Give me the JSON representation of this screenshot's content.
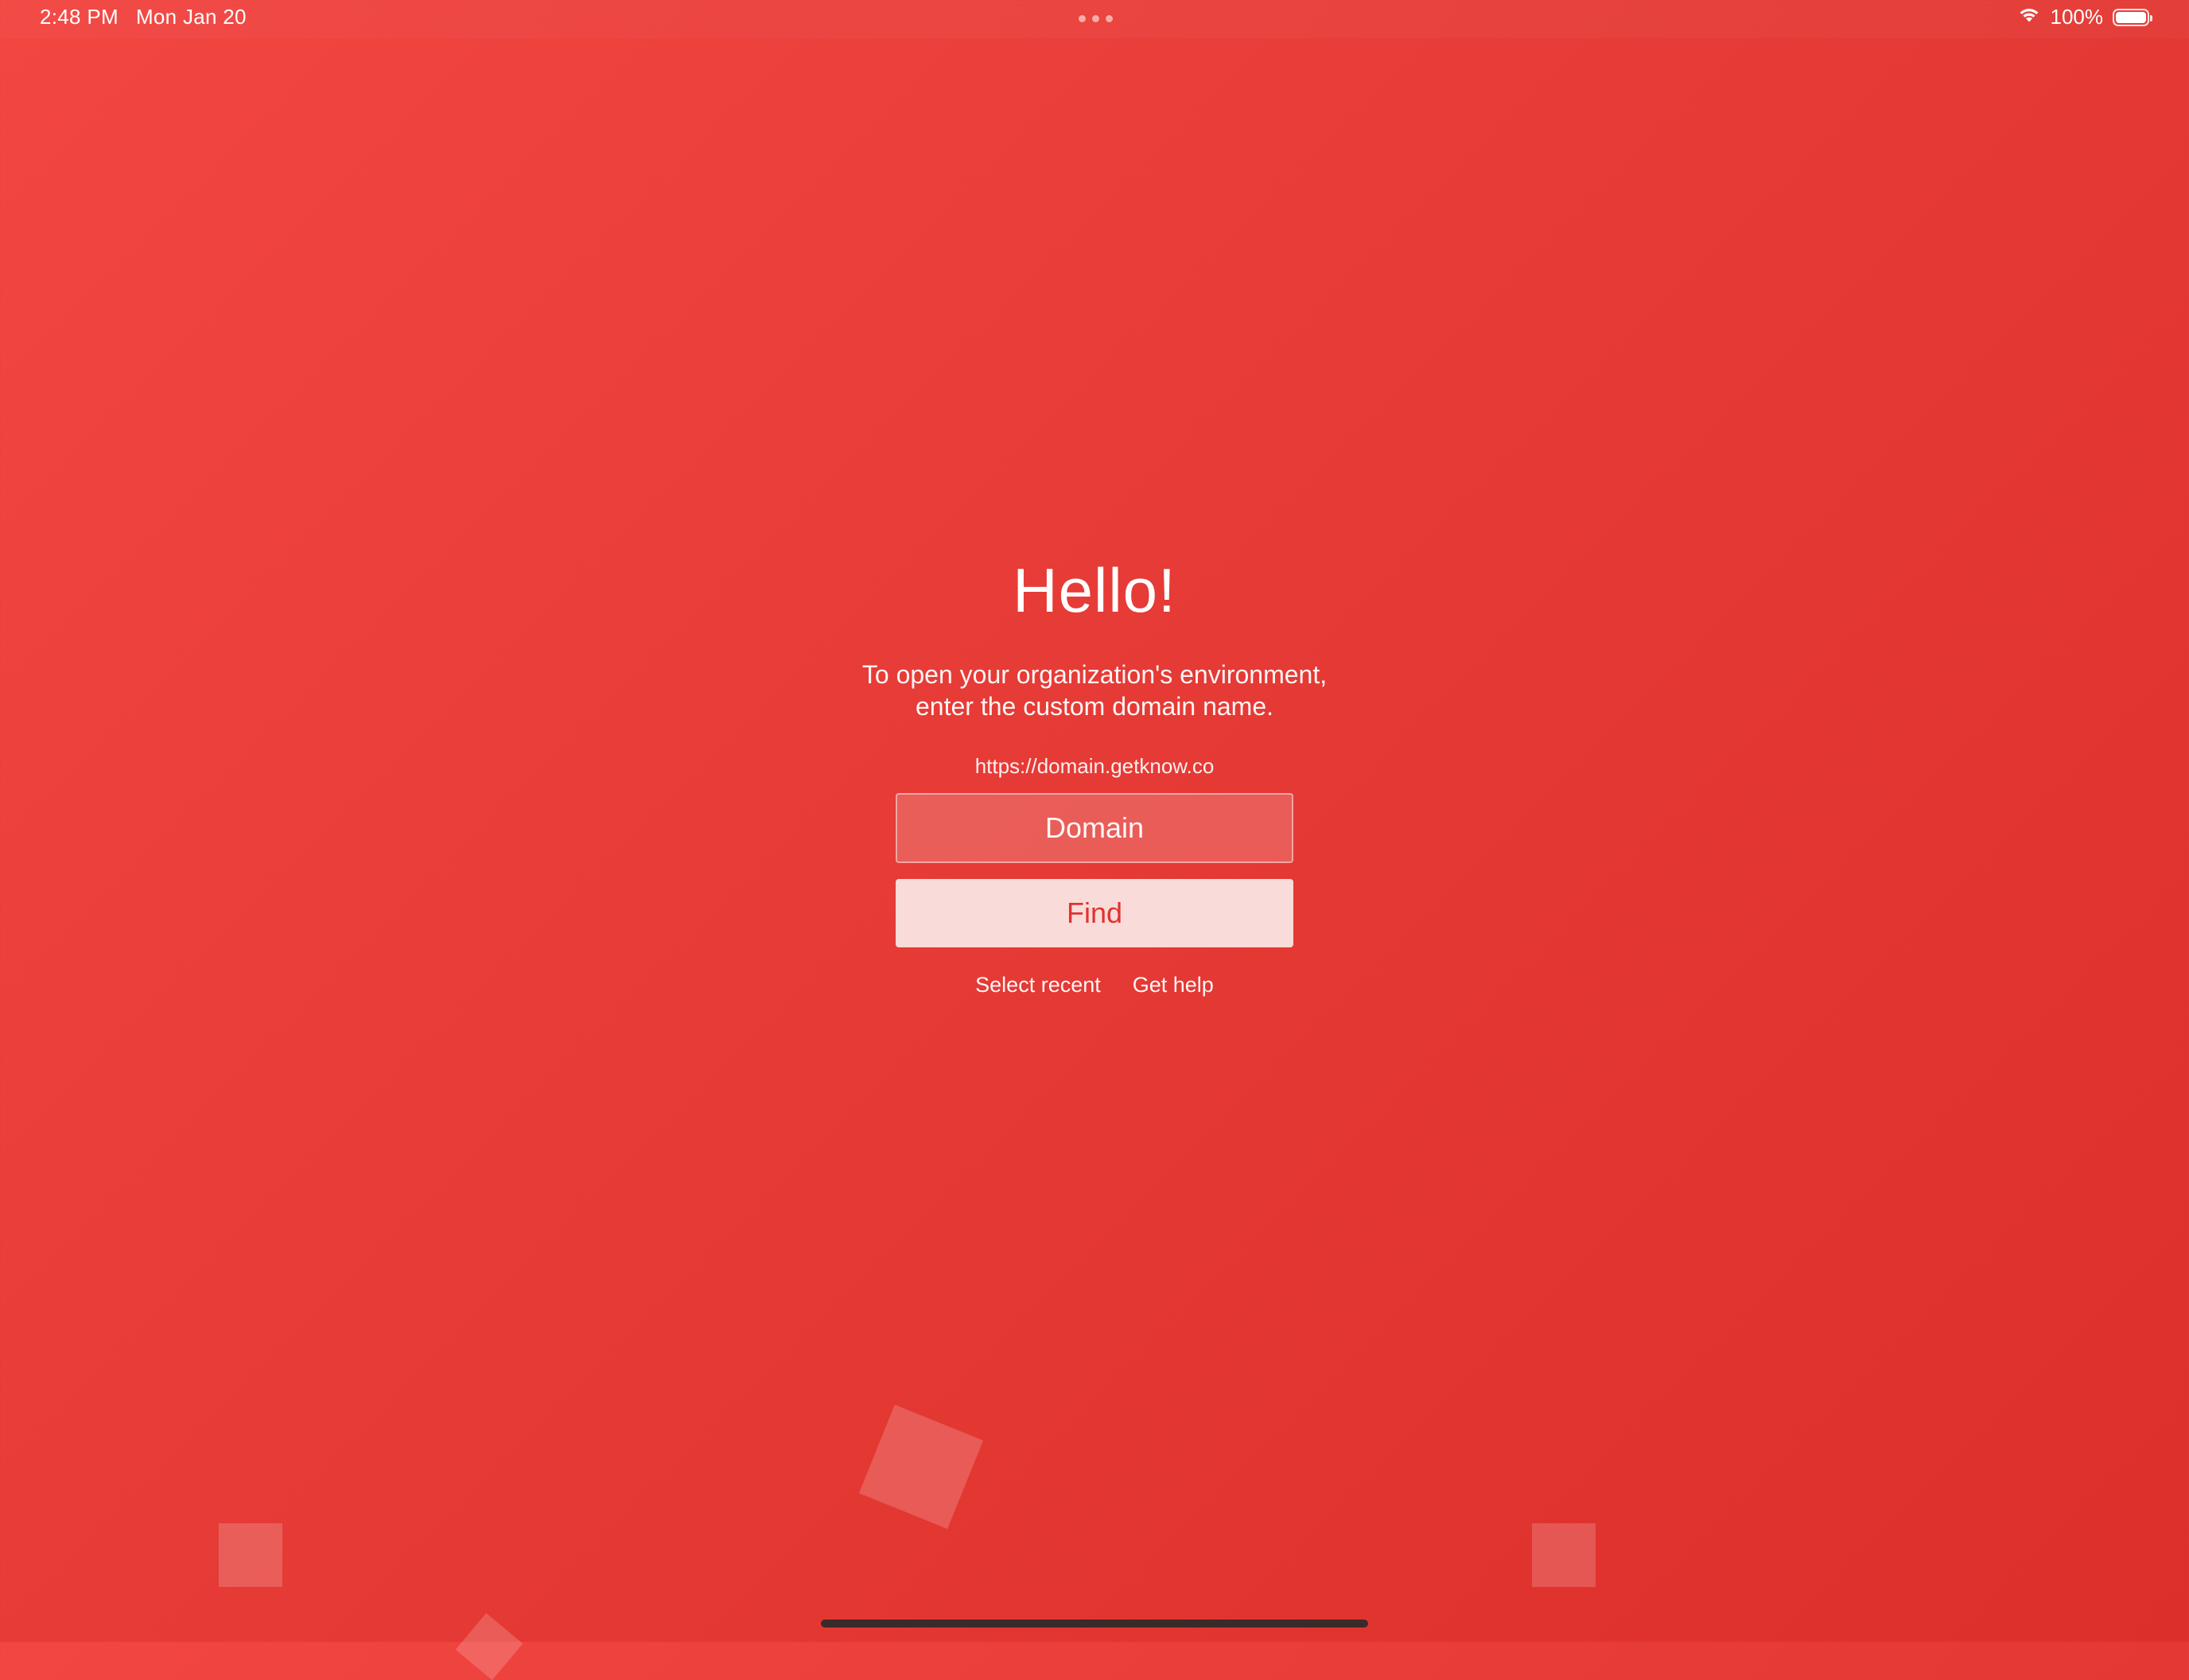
{
  "status_bar": {
    "time": "2:48 PM",
    "date": "Mon Jan 20",
    "battery": "100%",
    "battery_level": 1.0
  },
  "main": {
    "title": "Hello!",
    "subtitle": "To open your organization's environment,\nenter the custom domain name.",
    "domain_hint": "https://domain.getknow.co",
    "domain_input": {
      "placeholder": "Domain",
      "value": ""
    },
    "find_label": "Find",
    "links": {
      "select_recent": "Select recent",
      "get_help": "Get help"
    }
  },
  "icons": {
    "wifi": "wifi-icon",
    "battery": "battery-icon",
    "multitasking": "more-dots-icon"
  },
  "colors": {
    "background_start": "#f24641",
    "background_end": "#dd2f2a",
    "button_bg": "#f9dbd9",
    "button_text": "#e0332f"
  }
}
